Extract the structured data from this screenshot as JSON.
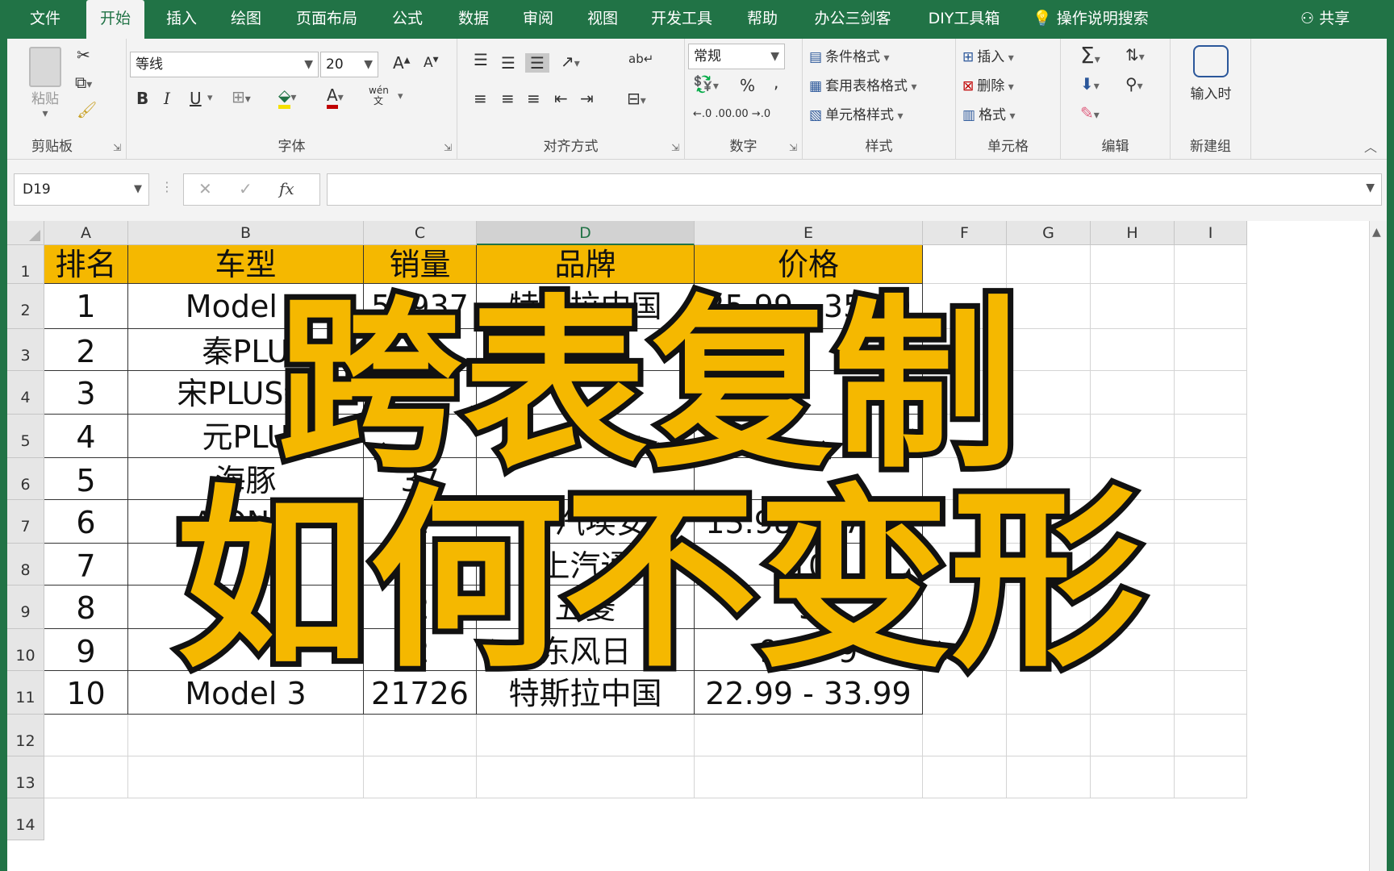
{
  "menu": {
    "tabs": [
      "文件",
      "开始",
      "插入",
      "绘图",
      "页面布局",
      "公式",
      "数据",
      "审阅",
      "视图",
      "开发工具",
      "帮助",
      "办公三剑客",
      "DIY工具箱"
    ],
    "active_tab": "开始",
    "tell_me": "操作说明搜索",
    "share": "共享"
  },
  "ribbon": {
    "clipboard": {
      "label": "剪贴板",
      "paste": "粘贴"
    },
    "font": {
      "label": "字体",
      "font_name": "等线",
      "font_size": "20",
      "bold": "B",
      "italic": "I",
      "underline": "U",
      "phonetic": "wén文"
    },
    "alignment": {
      "label": "对齐方式"
    },
    "number": {
      "label": "数字",
      "format": "常规",
      "percent": "%",
      "comma": ",",
      "inc_decimal": "←.0 .00",
      "dec_decimal": ".00 →.0"
    },
    "styles": {
      "label": "样式",
      "conditional": "条件格式",
      "table_format": "套用表格格式",
      "cell_style": "单元格样式"
    },
    "cells": {
      "label": "单元格",
      "insert": "插入",
      "delete": "删除",
      "format": "格式"
    },
    "editing": {
      "label": "编辑"
    },
    "new_group": {
      "label": "新建组",
      "button": "输入时"
    }
  },
  "formula_bar": {
    "name_box": "D19",
    "fx": "fx",
    "cancel": "✕",
    "confirm": "✓",
    "value": ""
  },
  "sheet": {
    "columns": [
      "A",
      "B",
      "C",
      "D",
      "E",
      "F",
      "G",
      "H",
      "I"
    ],
    "rows": [
      "1",
      "2",
      "3",
      "4",
      "5",
      "6",
      "7",
      "8",
      "9",
      "10",
      "11",
      "12",
      "13",
      "14"
    ],
    "header": [
      "排名",
      "车型",
      "销量",
      "品牌",
      "价格"
    ],
    "data": [
      [
        "1",
        "Model Y",
        "54937",
        "特斯拉中国",
        "25.99 - 35.99"
      ],
      [
        "2",
        "秦PLU",
        "5",
        "",
        ""
      ],
      [
        "3",
        "宋PLUS新",
        "",
        "",
        ""
      ],
      [
        "4",
        "元PLU",
        "",
        "",
        ""
      ],
      [
        "5",
        "海豚",
        "37",
        "",
        ""
      ],
      [
        "6",
        "AION S",
        "2",
        "广汽埃安",
        "13.98 - 17.98"
      ],
      [
        "7",
        "",
        "",
        "上汽通",
        "10"
      ],
      [
        "8",
        "宏",
        "2",
        "五菱",
        "3"
      ],
      [
        "9",
        "",
        "2",
        "东风日",
        "9.9 - 9"
      ],
      [
        "10",
        "Model 3",
        "21726",
        "特斯拉中国",
        "22.99 - 33.99"
      ]
    ]
  },
  "overlay": {
    "line1": "跨表复制",
    "line2": "如何不变形"
  },
  "colors": {
    "accent": "#217346",
    "header_fill": "#f5b800",
    "overlay_text": "#f5b800"
  }
}
